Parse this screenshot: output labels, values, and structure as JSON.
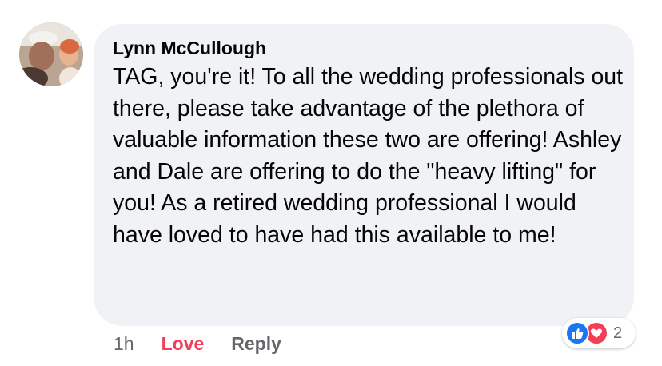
{
  "comment": {
    "author": "Lynn McCullough",
    "text": "TAG, you're it! To all the wedding professionals out there, please take advantage of the plethora of valuable information these two are offering! Ashley and Dale are offering to do the \"heavy lifting\" for you! As a retired wedding professional I would have loved to have had this available to me!",
    "timestamp": "1h",
    "love_label": "Love",
    "reply_label": "Reply",
    "reaction_count": "2",
    "reactions": [
      "like-icon",
      "love-icon"
    ]
  },
  "colors": {
    "bubble": "#f0f2f5",
    "love": "#f33e58",
    "like": "#1877f2",
    "muted": "#65676b"
  }
}
